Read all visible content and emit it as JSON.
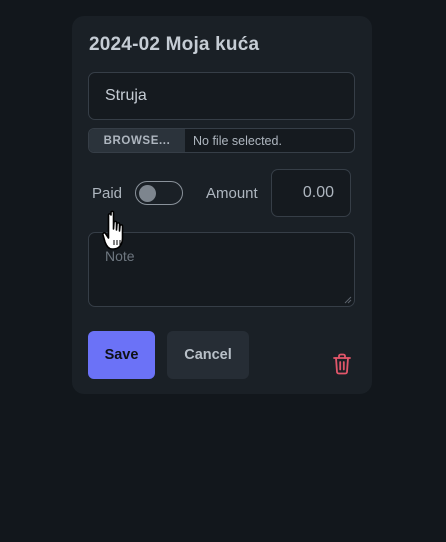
{
  "form": {
    "title": "2024-02 Moja kuća",
    "name_value": "Struja",
    "file": {
      "button_label": "BROWSE...",
      "status": "No file selected."
    },
    "paid": {
      "label": "Paid",
      "checked": false
    },
    "amount": {
      "label": "Amount",
      "value": "0.00"
    },
    "note": {
      "placeholder": "Note"
    },
    "buttons": {
      "save": "Save",
      "cancel": "Cancel"
    }
  },
  "icons": {
    "delete": "trash-icon",
    "cursor": "hand-pointer-cursor"
  },
  "colors": {
    "background": "#12171c",
    "card": "#1a2026",
    "primary": "#6b72f7",
    "danger": "#e2566a"
  }
}
